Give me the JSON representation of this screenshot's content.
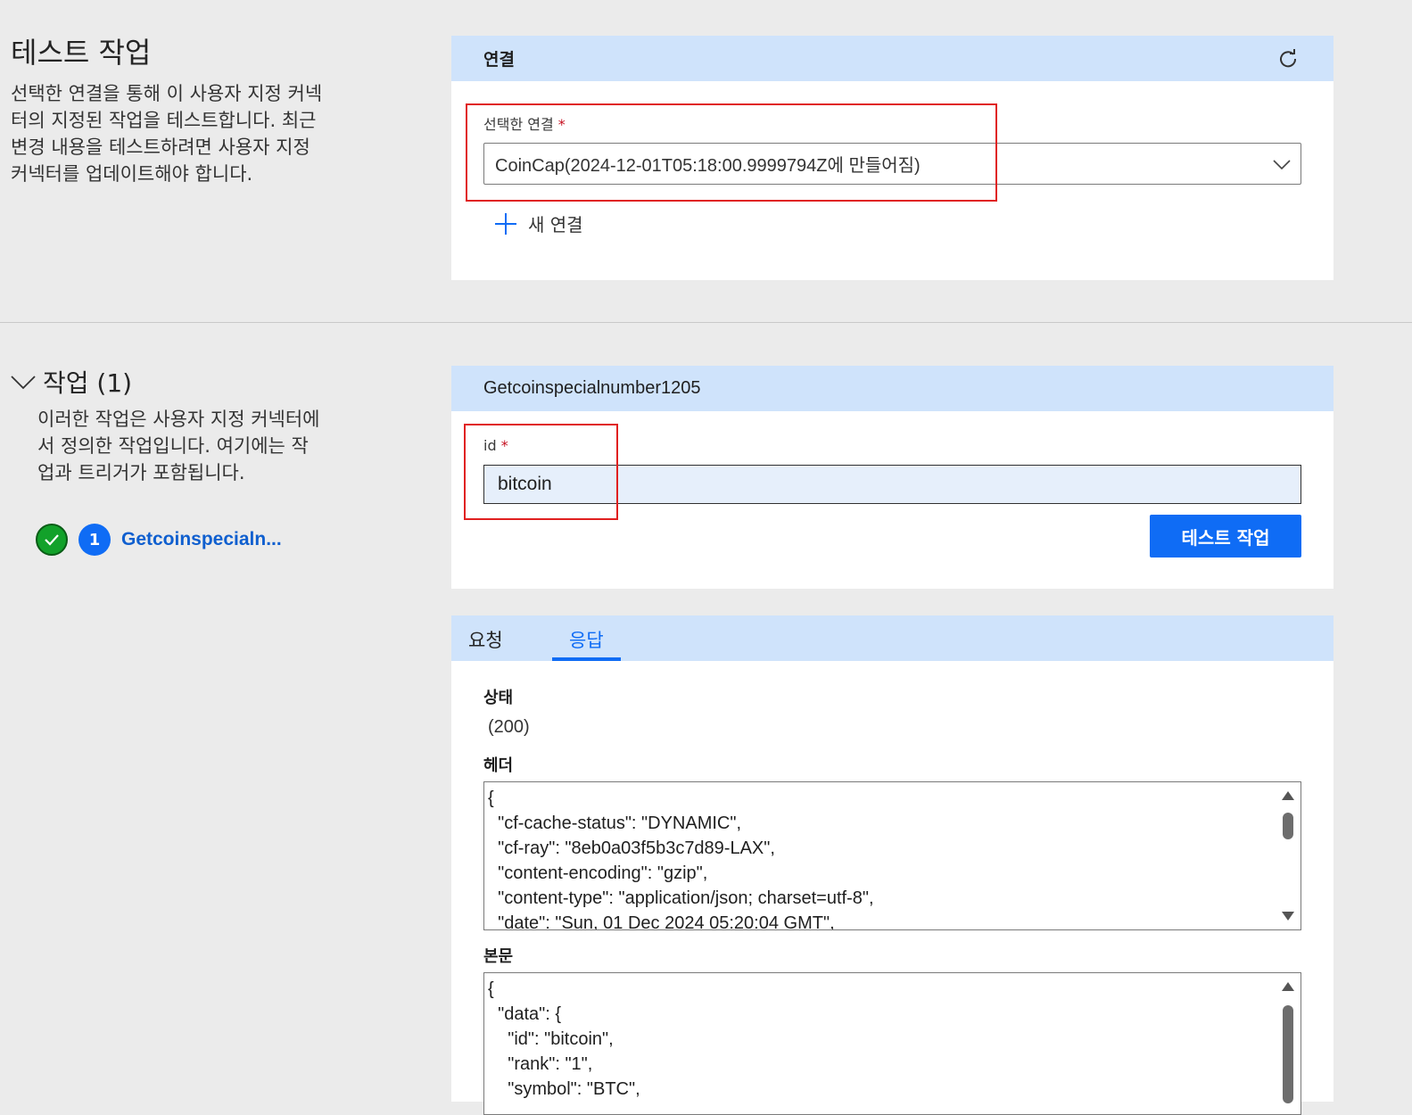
{
  "test_section": {
    "title": "테스트 작업",
    "description": "선택한 연결을 통해 이 사용자 지정 커넥터의 지정된 작업을 테스트합니다. 최근 변경 내용을 테스트하려면 사용자 지정 커넥터를 업데이트해야 합니다."
  },
  "connection_card": {
    "title": "연결",
    "refresh_icon": "refresh-icon",
    "selected_label": "선택한 연결",
    "required_mark": "*",
    "selected_value": "CoinCap(2024-12-01T05:18:00.9999794Z에 만들어짐)",
    "new_connection_label": "새 연결"
  },
  "operations": {
    "title": "작업 (1)",
    "description": "이러한 작업은 사용자 지정 커넥터에서 정의한 작업입니다. 여기에는 작업과 트리거가 포함됩니다.",
    "items": [
      {
        "status_icon": "check-icon",
        "number": "1",
        "name": "Getcoinspecialn..."
      }
    ]
  },
  "operation_card": {
    "title": "Getcoinspecialnumber1205",
    "id_label": "id",
    "required_mark": "*",
    "id_value": "bitcoin",
    "test_button_label": "테스트 작업"
  },
  "result_card": {
    "tabs": [
      {
        "label": "요청",
        "active": false
      },
      {
        "label": "응답",
        "active": true
      }
    ],
    "status_label": "상태",
    "status_value": "(200)",
    "headers_label": "헤더",
    "headers_text": "{\n  \"cf-cache-status\": \"DYNAMIC\",\n  \"cf-ray\": \"8eb0a03f5b3c7d89-LAX\",\n  \"content-encoding\": \"gzip\",\n  \"content-type\": \"application/json; charset=utf-8\",\n  \"date\": \"Sun, 01 Dec 2024 05:20:04 GMT\",",
    "body_label": "본문",
    "body_text": "{\n  \"data\": {\n    \"id\": \"bitcoin\",\n    \"rank\": \"1\",\n    \"symbol\": \"BTC\","
  },
  "colors": {
    "accent": "#0f6cf5",
    "header_bg": "#cfe3fb",
    "page_bg": "#ebebeb",
    "highlight_red": "#e02020",
    "success_green": "#12a12a"
  }
}
